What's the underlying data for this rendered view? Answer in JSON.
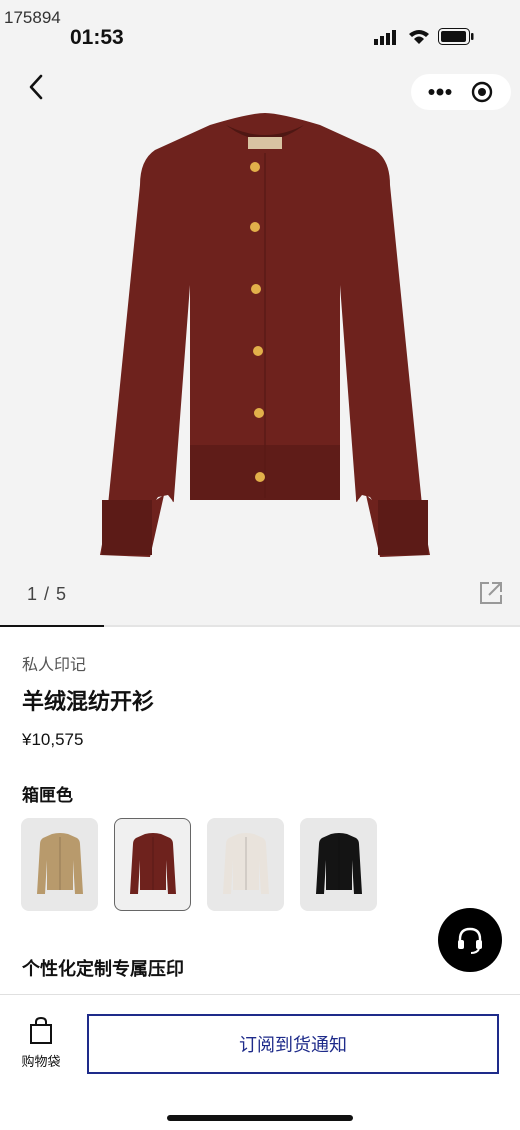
{
  "watermark": "175894",
  "status_bar": {
    "time": "01:53"
  },
  "nav": {
    "back_icon": "chevron-left-icon",
    "more_icon": "more-dots-icon",
    "close_icon": "target-circle-icon"
  },
  "gallery": {
    "counter": "1 / 5",
    "current": 1,
    "total": 5,
    "share_icon": "external-share-icon",
    "product_color": "#6e221d"
  },
  "product": {
    "collection": "私人印记",
    "title": "羊绒混纺开衫",
    "price": "¥10,575",
    "color_label": "箱匣色"
  },
  "swatches": [
    {
      "color": "#b89a6c",
      "selected": false
    },
    {
      "color": "#6e221d",
      "selected": true
    },
    {
      "color": "#e9e3dc",
      "selected": false
    },
    {
      "color": "#141414",
      "selected": false
    }
  ],
  "personalize_label": "个性化定制专属压印",
  "bottom": {
    "bag_label": "购物袋",
    "notify_label": "订阅到货通知"
  },
  "colors": {
    "accent": "#1e2b8a",
    "gallery_bg": "#f3f3f3"
  }
}
